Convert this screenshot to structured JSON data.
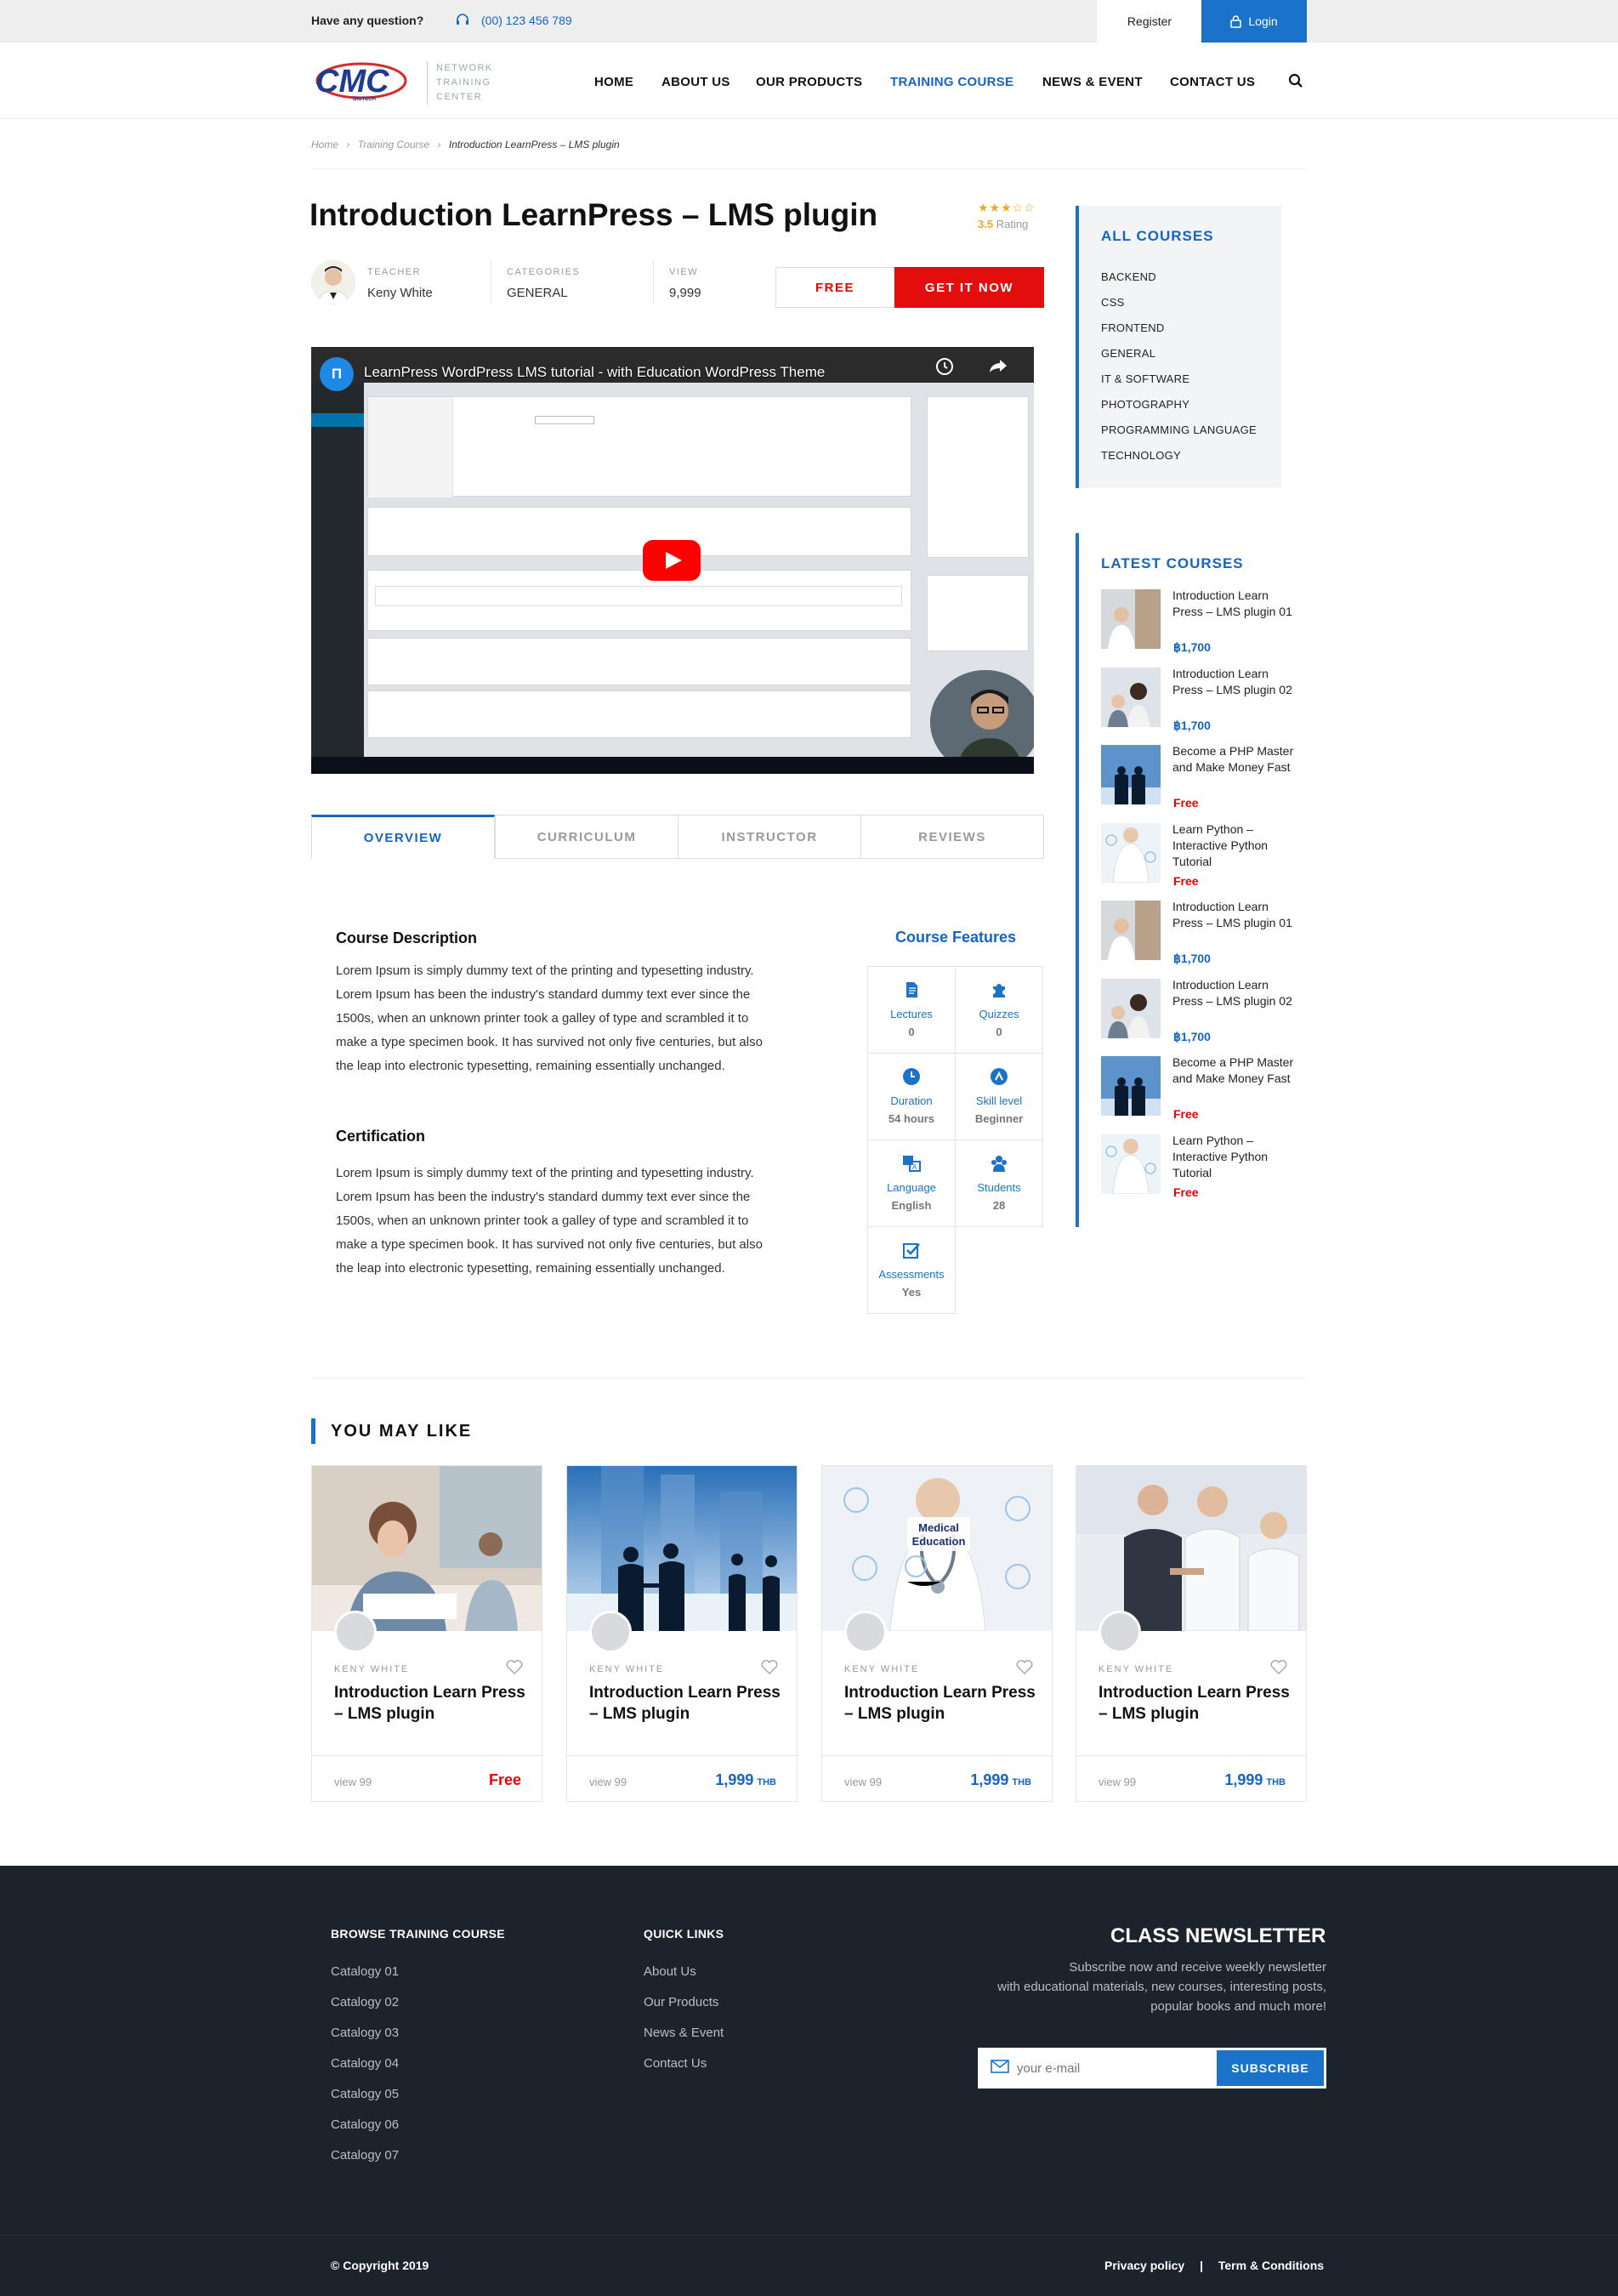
{
  "topbar": {
    "question": "Have any question?",
    "phone": "(00) 123 456 789",
    "register": "Register",
    "login": "Login"
  },
  "brand": {
    "logo_lines": [
      "NETWORK",
      "TRAINING",
      "CENTER"
    ],
    "logo_mark": "CMC",
    "logo_sub": "BIOTECH"
  },
  "nav": [
    "HOME",
    "ABOUT US",
    "OUR PRODUCTS",
    "TRAINING COURSE",
    "NEWS & EVENT",
    "CONTACT US"
  ],
  "breadcrumb": [
    "Home",
    "Training Course",
    "Introduction LearnPress – LMS plugin"
  ],
  "course": {
    "title": "Introduction LearnPress – LMS plugin",
    "stars": "★★★☆☆",
    "rating_value": "3.5",
    "rating_label": "Rating",
    "teacher_label": "TEACHER",
    "teacher": "Keny White",
    "categories_label": "CATEGORIES",
    "category": "GENERAL",
    "view_label": "VIEW",
    "views": "9,999",
    "free_btn": "FREE",
    "buy_btn": "GET IT NOW"
  },
  "video": {
    "title": "LearnPress WordPress LMS tutorial - with Education WordPress Theme"
  },
  "tabs": [
    "OVERVIEW",
    "CURRICULUM",
    "INSTRUCTOR",
    "REVIEWS"
  ],
  "overview": {
    "desc_title": "Course Description",
    "desc_lines": [
      "Lorem Ipsum is simply dummy text of the printing and typesetting industry.",
      "Lorem Ipsum has been the industry's standard dummy text ever since the",
      "1500s, when an unknown printer took a galley of type and scrambled it to",
      "make a type specimen book. It has survived not only five centuries, but also",
      "the leap into electronic typesetting, remaining essentially unchanged."
    ],
    "cert_title": "Certification",
    "cert_lines": [
      "Lorem Ipsum is simply dummy text of the printing and typesetting industry.",
      "Lorem Ipsum has been the industry's standard dummy text ever since the",
      "1500s, when an unknown printer took a galley of type and scrambled it to",
      "make a type specimen book. It has survived not only five centuries, but also",
      "the leap into electronic typesetting, remaining essentially unchanged."
    ]
  },
  "features": {
    "title": "Course Features",
    "items": [
      {
        "label": "Lectures",
        "value": "0",
        "icon": "document-icon"
      },
      {
        "label": "Quizzes",
        "value": "0",
        "icon": "puzzle-icon"
      },
      {
        "label": "Duration",
        "value": "54 hours",
        "icon": "clock-icon"
      },
      {
        "label": "Skill level",
        "value": "Beginner",
        "icon": "level-icon"
      },
      {
        "label": "Language",
        "value": "English",
        "icon": "language-icon"
      },
      {
        "label": "Students",
        "value": "28",
        "icon": "users-icon"
      },
      {
        "label": "Assessments",
        "value": "Yes",
        "icon": "checkbox-icon"
      }
    ]
  },
  "sidebar": {
    "all_title": "ALL COURSES",
    "categories": [
      "BACKEND",
      "CSS",
      "FRONTEND",
      "GENERAL",
      "IT & SOFTWARE",
      "PHOTOGRAPHY",
      "PROGRAMMING LANGUAGE",
      "TECHNOLOGY"
    ],
    "latest_title": "LATEST COURSES",
    "latest": [
      {
        "lines": [
          "Introduction Learn",
          "Press – LMS plugin 01"
        ],
        "price": "฿1,700",
        "free": false
      },
      {
        "lines": [
          "Introduction Learn",
          "Press – LMS plugin 02"
        ],
        "price": "฿1,700",
        "free": false
      },
      {
        "lines": [
          "Become a PHP Master",
          "and Make Money Fast"
        ],
        "price": "Free",
        "free": true
      },
      {
        "lines": [
          "Learn Python –",
          "Interactive Python",
          "Tutorial"
        ],
        "price": "Free",
        "free": true
      },
      {
        "lines": [
          "Introduction Learn",
          "Press – LMS plugin 01"
        ],
        "price": "฿1,700",
        "free": false
      },
      {
        "lines": [
          "Introduction Learn",
          "Press – LMS plugin 02"
        ],
        "price": "฿1,700",
        "free": false
      },
      {
        "lines": [
          "Become a PHP Master",
          "and Make Money Fast"
        ],
        "price": "Free",
        "free": true
      },
      {
        "lines": [
          "Learn Python –",
          "Interactive Python",
          "Tutorial"
        ],
        "price": "Free",
        "free": true
      }
    ]
  },
  "you_may_like": {
    "title": "YOU MAY LIKE",
    "cards": [
      {
        "author": "KENY WHITE",
        "title": "Introduction Learn Press – LMS plugin",
        "views": "view 99",
        "price": "Free",
        "currency": "",
        "free": true
      },
      {
        "author": "KENY WHITE",
        "title": "Introduction Learn Press – LMS plugin",
        "views": "view 99",
        "price": "1,999",
        "currency": "THB",
        "free": false
      },
      {
        "author": "KENY WHITE",
        "title": "Introduction Learn Press – LMS plugin",
        "views": "view 99",
        "price": "1,999",
        "currency": "THB",
        "free": false
      },
      {
        "author": "KENY WHITE",
        "title": "Introduction Learn Press – LMS plugin",
        "views": "view 99",
        "price": "1,999",
        "currency": "THB",
        "free": false
      }
    ],
    "medical_label": [
      "Medical",
      "Education"
    ]
  },
  "footer": {
    "browse_title": "BROWSE TRAINING COURSE",
    "browse": [
      "Catalogy 01",
      "Catalogy 02",
      "Catalogy 03",
      "Catalogy 04",
      "Catalogy 05",
      "Catalogy 06",
      "Catalogy 07"
    ],
    "quick_title": "QUICK LINKS",
    "quick": [
      "About Us",
      "Our Products",
      "News & Event",
      "Contact Us"
    ],
    "newsletter_title": "CLASS NEWSLETTER",
    "newsletter_desc": [
      "Subscribe now and receive weekly newsletter",
      "with educational materials, new courses, interesting posts,",
      "popular books and much more!"
    ],
    "email_placeholder": "your e-mail",
    "subscribe": "SUBSCRIBE",
    "copyright": "© Copyright 2019",
    "privacy": "Privacy policy",
    "sep": "|",
    "terms": "Term & Conditions"
  },
  "colors": {
    "accent": "#1a73c8",
    "red": "#e40d0d",
    "footer_bg": "#1d232d"
  }
}
